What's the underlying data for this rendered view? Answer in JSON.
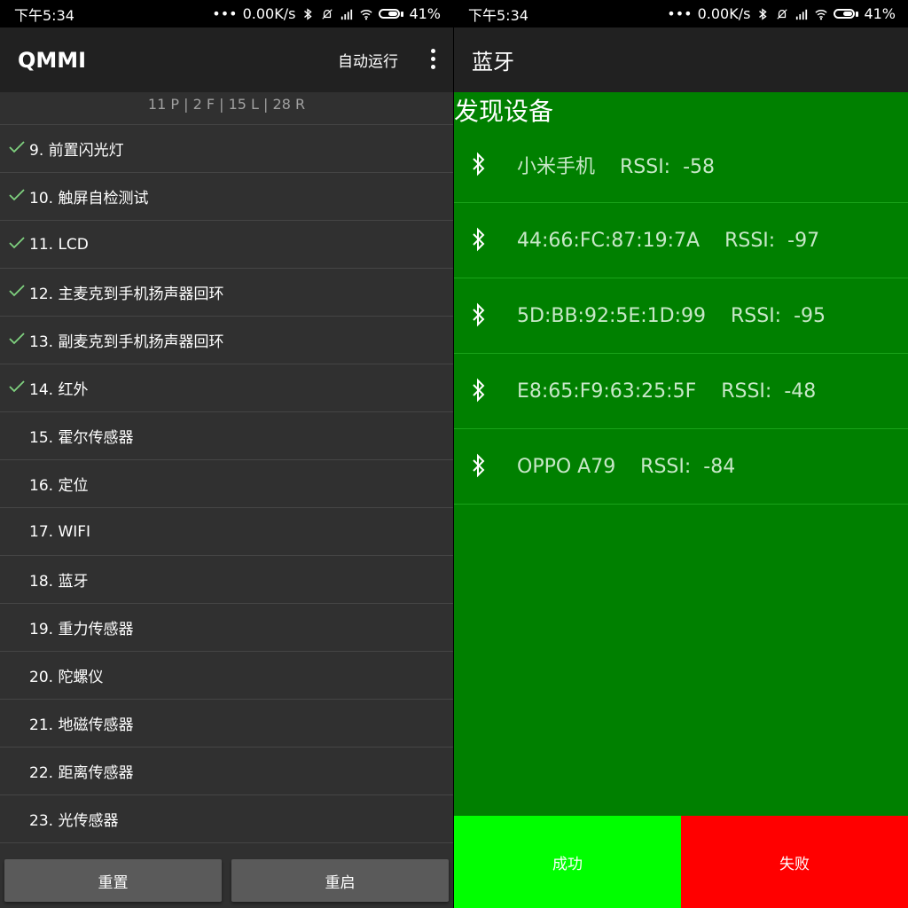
{
  "left": {
    "status": {
      "time": "下午5:34",
      "dots": "•••",
      "speed": "0.00K/s",
      "battery": "41%"
    },
    "app_title": "QMMI",
    "auto_run": "自动运行",
    "summary": "11 P | 2 F  | 15 L | 28 R",
    "items": [
      {
        "label": "9. 前置闪光灯",
        "checked": true
      },
      {
        "label": "10. 触屏自检测试",
        "checked": true
      },
      {
        "label": "11. LCD",
        "checked": true
      },
      {
        "label": "12. 主麦克到手机扬声器回环",
        "checked": true
      },
      {
        "label": "13. 副麦克到手机扬声器回环",
        "checked": true
      },
      {
        "label": "14. 红外",
        "checked": true
      },
      {
        "label": "15. 霍尔传感器",
        "checked": false
      },
      {
        "label": "16. 定位",
        "checked": false
      },
      {
        "label": "17. WIFI",
        "checked": false
      },
      {
        "label": "18. 蓝牙",
        "checked": false
      },
      {
        "label": "19. 重力传感器",
        "checked": false
      },
      {
        "label": "20. 陀螺仪",
        "checked": false
      },
      {
        "label": "21. 地磁传感器",
        "checked": false
      },
      {
        "label": "22. 距离传感器",
        "checked": false
      },
      {
        "label": "23. 光传感器",
        "checked": false
      }
    ],
    "buttons": {
      "reset": "重置",
      "restart": "重启"
    }
  },
  "right": {
    "status": {
      "time": "下午5:34",
      "dots": "•••",
      "speed": "0.00K/s",
      "battery": "41%"
    },
    "title": "蓝牙",
    "section_title": "发现设备",
    "devices": [
      {
        "name": "小米手机    RSSI:  -58"
      },
      {
        "name": "44:66:FC:87:19:7A    RSSI:  -97"
      },
      {
        "name": "5D:BB:92:5E:1D:99    RSSI:  -95"
      },
      {
        "name": "E8:65:F9:63:25:5F    RSSI:  -48"
      },
      {
        "name": "OPPO A79    RSSI:  -84"
      }
    ],
    "success_label": "成功",
    "fail_label": "失败"
  },
  "colors": {
    "panel_bg": "#303030",
    "appbar_bg": "#212121",
    "check": "#7fd17f",
    "bt_green": "#008000",
    "success": "#00ff00",
    "fail": "#ff0000"
  },
  "icons": {
    "status": [
      "bluetooth-icon",
      "mute-icon",
      "signal-icon",
      "wifi-icon",
      "battery-icon"
    ],
    "more": "more-vert-icon",
    "check": "check-icon",
    "device": "bluetooth-icon"
  }
}
